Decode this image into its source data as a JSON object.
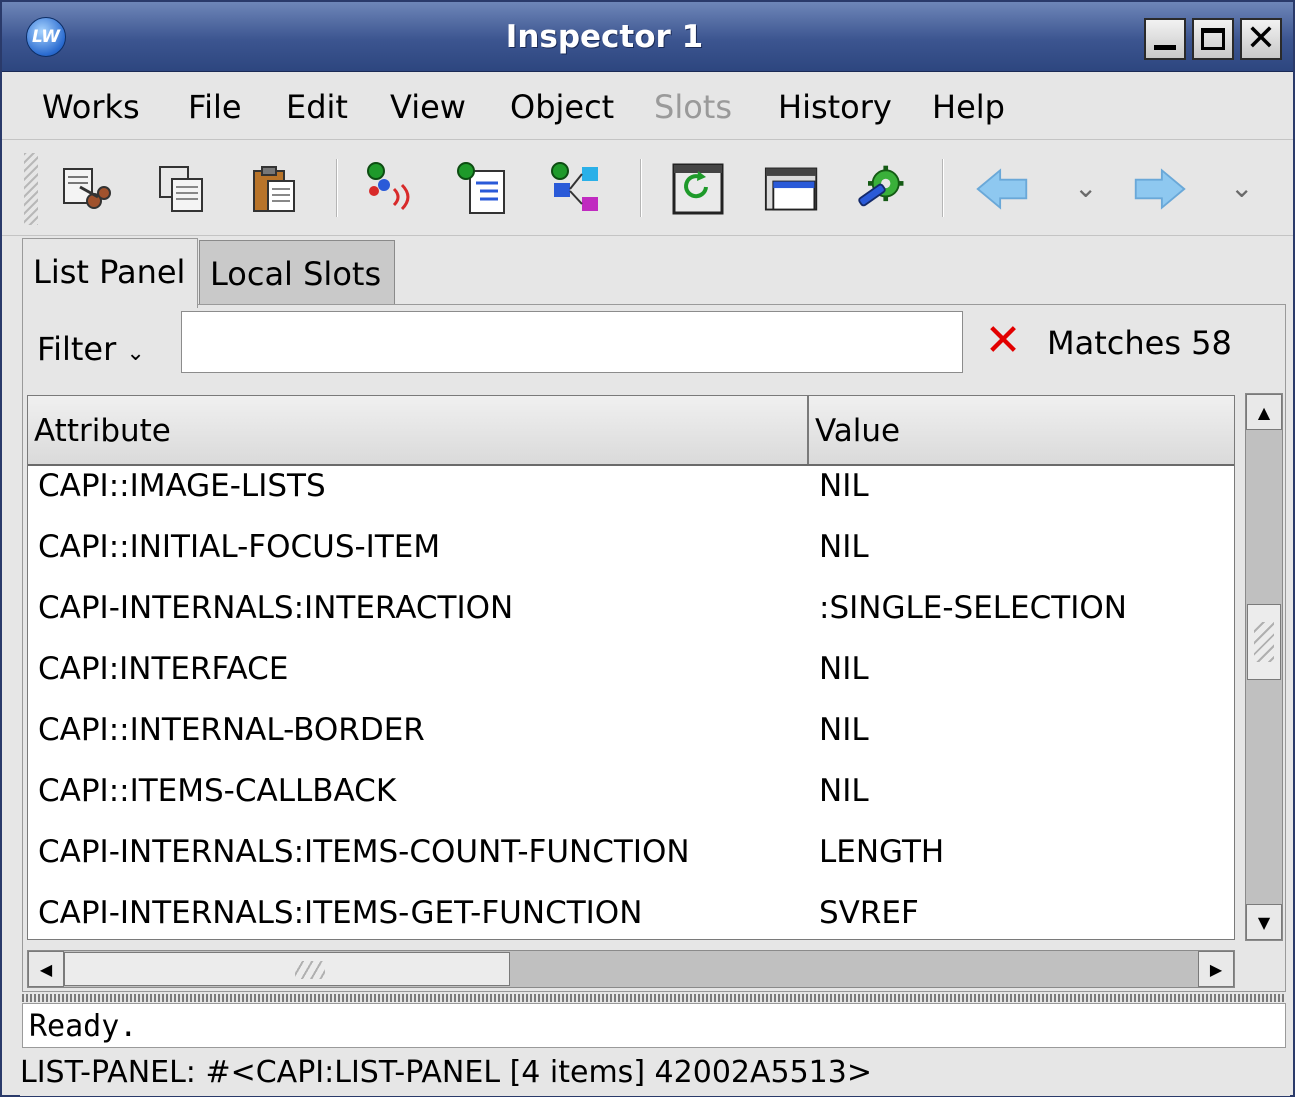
{
  "window": {
    "title": "Inspector 1",
    "app_icon_text": "LW"
  },
  "menubar": {
    "items": [
      {
        "label": "Works",
        "enabled": true
      },
      {
        "label": "File",
        "enabled": true
      },
      {
        "label": "Edit",
        "enabled": true
      },
      {
        "label": "View",
        "enabled": true
      },
      {
        "label": "Object",
        "enabled": true
      },
      {
        "label": "Slots",
        "enabled": false
      },
      {
        "label": "History",
        "enabled": true
      },
      {
        "label": "Help",
        "enabled": true
      }
    ]
  },
  "toolbar": {
    "icons": [
      "cut-icon",
      "copy-icon",
      "paste-icon",
      "inspect-object-icon",
      "browse-class-icon",
      "debug-tree-icon",
      "refresh-icon",
      "window-icon",
      "settings-gear-icon",
      "back-arrow-icon",
      "forward-arrow-icon"
    ]
  },
  "tabs": [
    {
      "label": "List Panel",
      "active": true
    },
    {
      "label": "Local Slots",
      "active": false
    }
  ],
  "filter": {
    "label": "Filter",
    "value": "",
    "matches_text": "Matches 58"
  },
  "table": {
    "columns": [
      "Attribute",
      "Value"
    ],
    "rows": [
      {
        "attribute": "CAPI::IMAGE-LISTS",
        "value": "NIL"
      },
      {
        "attribute": "CAPI::INITIAL-FOCUS-ITEM",
        "value": "NIL"
      },
      {
        "attribute": "CAPI-INTERNALS:INTERACTION",
        "value": ":SINGLE-SELECTION"
      },
      {
        "attribute": "CAPI:INTERFACE",
        "value": "NIL"
      },
      {
        "attribute": "CAPI::INTERNAL-BORDER",
        "value": "NIL"
      },
      {
        "attribute": "CAPI::ITEMS-CALLBACK",
        "value": "NIL"
      },
      {
        "attribute": "CAPI-INTERNALS:ITEMS-COUNT-FUNCTION",
        "value": "LENGTH"
      },
      {
        "attribute": "CAPI-INTERNALS:ITEMS-GET-FUNCTION",
        "value": "SVREF"
      }
    ]
  },
  "status": {
    "message": "Ready.",
    "description": "LIST-PANEL: #<CAPI:LIST-PANEL [4 items] 42002A5513>"
  },
  "colors": {
    "titlebar": "#3c5590",
    "background": "#e6e6e6",
    "clear_x": "#e20000"
  }
}
